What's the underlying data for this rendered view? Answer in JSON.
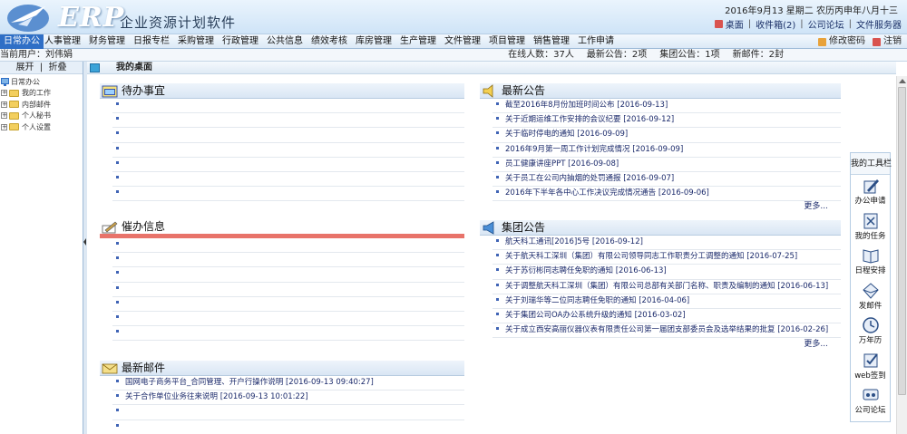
{
  "header": {
    "logo_text": "ERP",
    "app_name": "企业资源计划软件",
    "date_line": "2016年9月13  星期二  农历丙申年八月十三",
    "links": [
      {
        "label": "桌面",
        "icon": "desktop-icon",
        "color": "#d9534f"
      },
      {
        "label": "收件箱(2)"
      },
      {
        "label": "公司论坛"
      },
      {
        "label": "文件服务器"
      }
    ]
  },
  "nav": {
    "items": [
      "日常办公",
      "人事管理",
      "财务管理",
      "日报专栏",
      "采购管理",
      "行政管理",
      "公共信息",
      "绩效考核",
      "库房管理",
      "生产管理",
      "文件管理",
      "项目管理",
      "销售管理",
      "工作申请"
    ],
    "active": "日常办公",
    "change_password": "修改密码",
    "logout": "注销",
    "accent_color": "#2f6fc6"
  },
  "status": {
    "current_user": "当前用户：刘伟娟",
    "online": "在线人数：37人",
    "latest_notice": "最新公告：2项",
    "group_notice": "集团公告：1项",
    "new_mail": "新邮件：2封"
  },
  "left": {
    "expand": "展开",
    "collapse": "折叠",
    "root": "日常办公",
    "nodes": [
      "我的工作",
      "内部邮件",
      "个人秘书",
      "个人设置"
    ]
  },
  "desk": {
    "title": "我的桌面"
  },
  "todo": {
    "title": "待办事宜",
    "empty_rows": 7
  },
  "pending": {
    "title": "催办信息",
    "empty_rows": 7
  },
  "notices": {
    "title": "最新公告",
    "items": [
      {
        "text": "截至2016年8月份加班时间公布",
        "date": "[2016-09-13]"
      },
      {
        "text": "关于近期运维工作安排的会议纪要",
        "date": "[2016-09-12]"
      },
      {
        "text": "关于临时停电的通知",
        "date": "[2016-09-09]"
      },
      {
        "text": "2016年9月第一周工作计划完成情况",
        "date": "[2016-09-09]"
      },
      {
        "text": "员工健康讲座PPT",
        "date": "[2016-09-08]"
      },
      {
        "text": "关于员工在公司内抽烟的处罚通报",
        "date": "[2016-09-07]"
      },
      {
        "text": "2016年下半年各中心工作决议完成情况通告",
        "date": "[2016-09-06]"
      }
    ],
    "more": "更多..."
  },
  "group": {
    "title": "集团公告",
    "items": [
      {
        "text": "航天科工通讯[2016]5号",
        "date": "[2016-09-12]"
      },
      {
        "text": "关于航天科工深圳（集团）有限公司领导同志工作职责分工调整的通知",
        "date": "[2016-07-25]"
      },
      {
        "text": "关于苏衍彬同志聘任免职的通知",
        "date": "[2016-06-13]"
      },
      {
        "text": "关于调整航天科工深圳（集团）有限公司总部有关部门名称、职责及编制的通知",
        "date": "[2016-06-13]"
      },
      {
        "text": "关于刘瑞华等二位同志聘任免职的通知",
        "date": "[2016-04-06]"
      },
      {
        "text": "关于集团公司OA办公系统升级的通知",
        "date": "[2016-03-02]"
      },
      {
        "text": "关于成立西安高丽仪器仪表有限责任公司第一届团支部委员会及选举结果的批复",
        "date": "[2016-02-26]"
      }
    ],
    "more": "更多..."
  },
  "mail": {
    "title": "最新邮件",
    "items": [
      {
        "text": "国网电子商务平台_合同管理、开户行操作说明",
        "date": "[2016-09-13 09:40:27]"
      },
      {
        "text": "关于合作单位业务往来说明",
        "date": "[2016-09-13 10:01:22]"
      }
    ],
    "empty_rows": 3
  },
  "toolbox": {
    "title": "我的工具栏",
    "tools": [
      {
        "label": "办公申请",
        "icon": "pen-paper-icon"
      },
      {
        "label": "我的任务",
        "icon": "task-icon"
      },
      {
        "label": "日程安排",
        "icon": "book-icon"
      },
      {
        "label": "发邮件",
        "icon": "envelope-icon"
      },
      {
        "label": "万年历",
        "icon": "clock-icon"
      },
      {
        "label": "web签到",
        "icon": "checkbox-icon"
      },
      {
        "label": "公司论坛",
        "icon": "forum-icon"
      }
    ]
  }
}
